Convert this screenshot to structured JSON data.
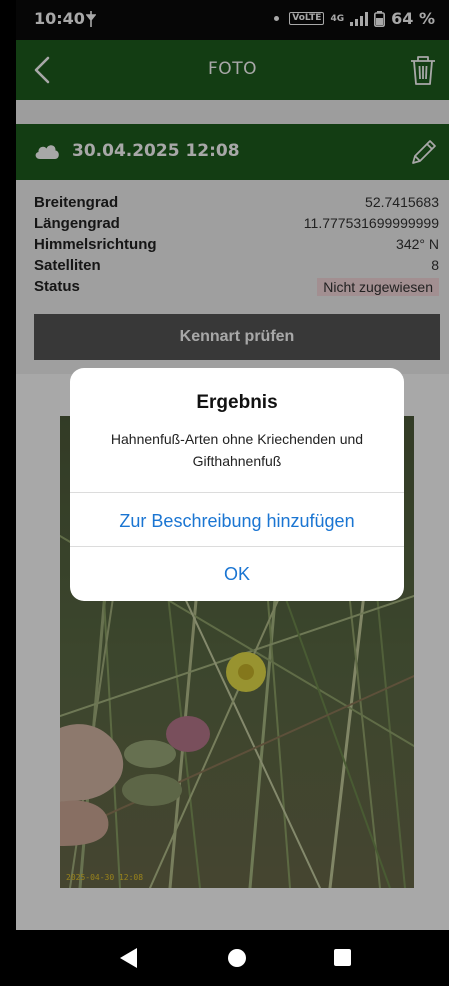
{
  "status_bar": {
    "time": "10:40",
    "network_badge": "VoLTE",
    "network": "4G",
    "battery": "64 %"
  },
  "app_bar": {
    "title": "FOTO",
    "icons": [
      "back-arrow-icon",
      "trash-icon"
    ]
  },
  "photo_header": {
    "date": "30.04.2025 12:08",
    "icons": [
      "cloud-icon",
      "pencil-icon"
    ]
  },
  "details": {
    "rows": [
      {
        "label": "Breitengrad",
        "value": "52.7415683"
      },
      {
        "label": "Längengrad",
        "value": "11.777531699999999"
      },
      {
        "label": "Himmelsrichtung",
        "value": "342° N"
      },
      {
        "label": "Satelliten",
        "value": "8"
      },
      {
        "label": "Status",
        "value": "Nicht zugewiesen"
      }
    ],
    "check_button": "Kennart prüfen"
  },
  "photo": {
    "timestamp": "2025-04-30 12:08"
  },
  "dialog": {
    "title": "Ergebnis",
    "message": "Hahnenfuß-Arten ohne Kriechenden und Gifthahnenfuß",
    "add_button": "Zur Beschreibung hinzufügen",
    "ok_button": "OK"
  },
  "colors": {
    "brand_green": "#1e5d1d",
    "dialog_accent": "#1a75d2",
    "status_badge_bg": "#f6d9dc"
  }
}
